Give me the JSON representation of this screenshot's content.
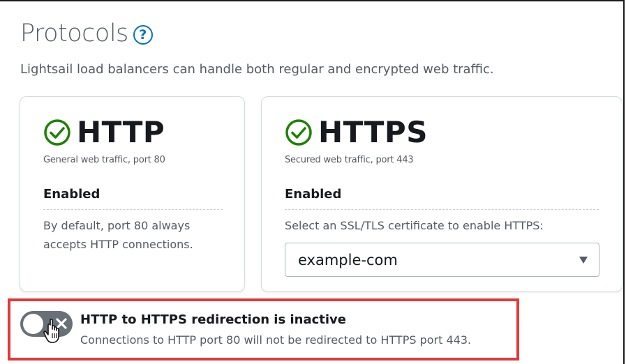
{
  "section": {
    "title": "Protocols",
    "help_glyph": "?",
    "subtitle": "Lightsail load balancers can handle both regular and encrypted web traffic."
  },
  "cards": {
    "http": {
      "title": "HTTP",
      "description": "General web traffic, port 80",
      "status": "Enabled",
      "note_line1": "By default, port 80 always",
      "note_line2": "accepts HTTP connections.",
      "icon": "check-circle-icon"
    },
    "https": {
      "title": "HTTPS",
      "description": "Secured web traffic, port 443",
      "status": "Enabled",
      "note": "Select an SSL/TLS certificate to enable HTTPS:",
      "certificate_selected": "example-com",
      "icon": "check-circle-icon"
    }
  },
  "redirection": {
    "toggle_state": "off",
    "title": "HTTP to HTTPS redirection is inactive",
    "description": "Connections to HTTP port 80 will not be redirected to HTTPS port 443."
  },
  "colors": {
    "success_green": "#1d8102",
    "link_blue": "#0073bb",
    "highlight_red": "#e4383a",
    "toggle_off_gray": "#687078"
  }
}
